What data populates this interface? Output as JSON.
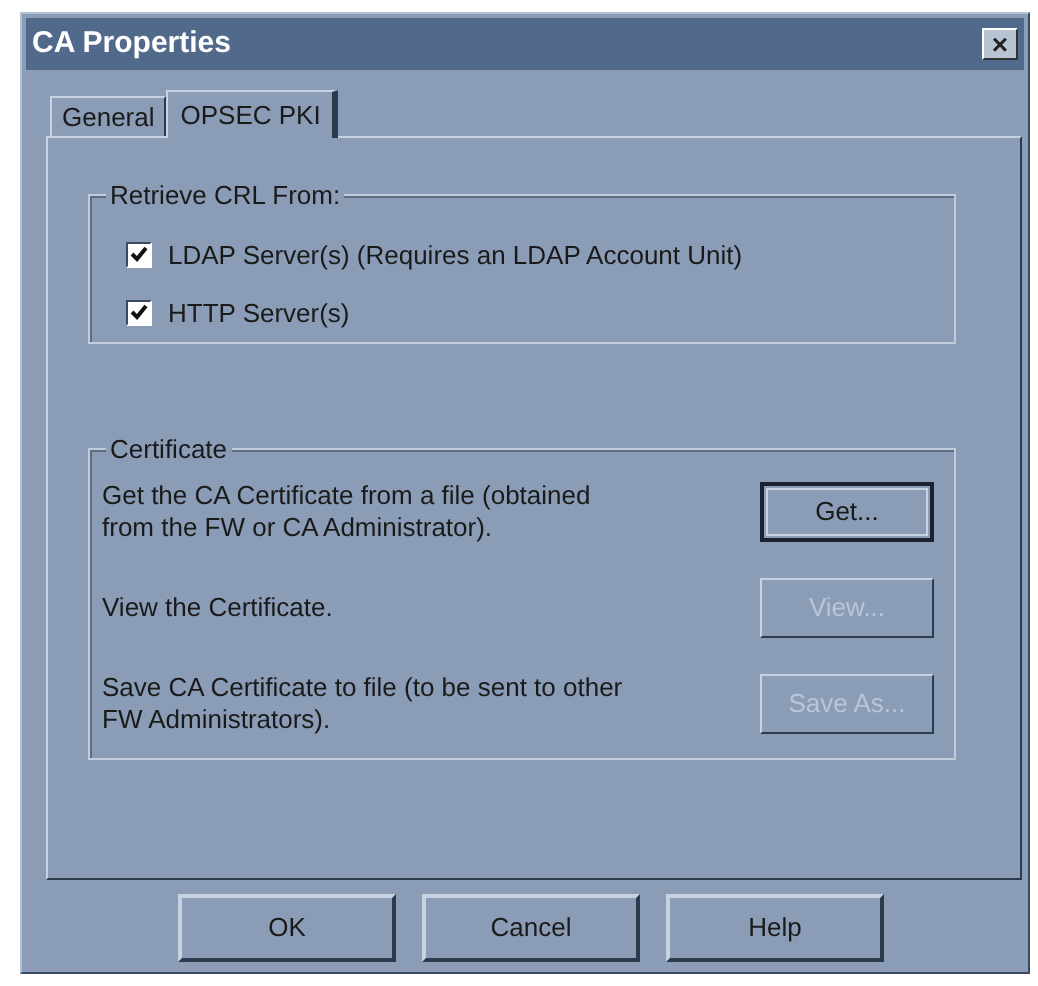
{
  "window": {
    "title": "CA Properties",
    "close": "×"
  },
  "tabs": [
    {
      "label": "General",
      "selected": false
    },
    {
      "label": "OPSEC PKI",
      "selected": true
    }
  ],
  "retrieve_crl": {
    "title": "Retrieve CRL From:",
    "options": [
      {
        "label": "LDAP Server(s) (Requires an LDAP Account Unit)",
        "checked": true
      },
      {
        "label": "HTTP Server(s)",
        "checked": true
      }
    ]
  },
  "certificate": {
    "title": "Certificate",
    "rows": [
      {
        "text": "Get the CA Certificate from a file (obtained from the FW or CA Administrator).",
        "button": "Get...",
        "disabled": false,
        "default": true
      },
      {
        "text": "View the Certificate.",
        "button": "View...",
        "disabled": true,
        "default": false
      },
      {
        "text": "Save CA Certificate to file (to be sent to other FW Administrators).",
        "button": "Save As...",
        "disabled": true,
        "default": false
      }
    ]
  },
  "buttons": [
    "OK",
    "Cancel",
    "Help"
  ]
}
